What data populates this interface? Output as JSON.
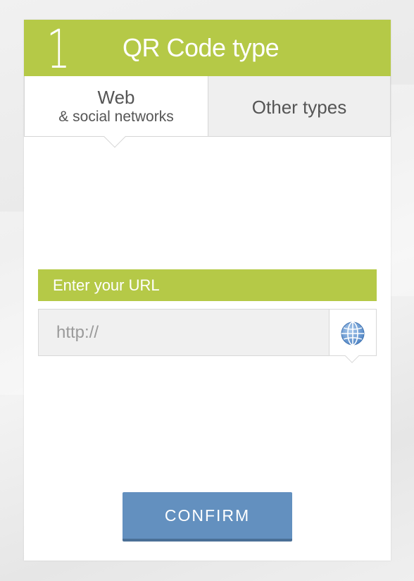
{
  "header": {
    "step_number": "1",
    "title": "QR Code type",
    "color": "#b5c947"
  },
  "tabs": [
    {
      "label": "Web",
      "sublabel": "& social networks",
      "active": true
    },
    {
      "label": "Other types",
      "active": false
    }
  ],
  "url_section": {
    "label": "Enter your URL",
    "input_value": "",
    "input_placeholder": "http://",
    "globe_icon": "globe-icon"
  },
  "confirm": {
    "label": "CONFIRM",
    "color": "#6390bf"
  }
}
